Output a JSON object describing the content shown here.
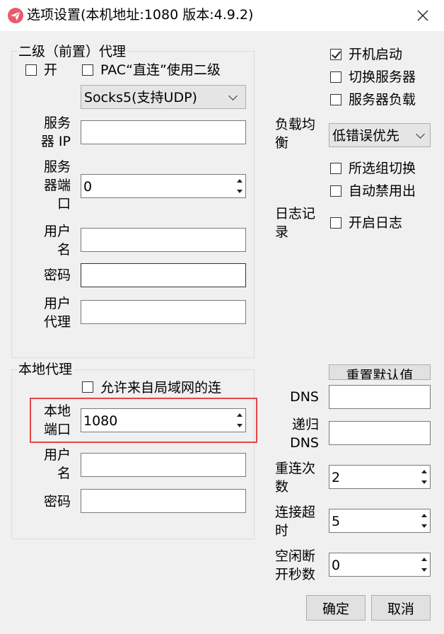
{
  "window": {
    "title": "选项设置(本机地址:1080 版本:4.9.2)"
  },
  "icons": {
    "app": "paper-plane-icon",
    "close": "close-icon"
  },
  "colors": {
    "highlight": "#e64545"
  },
  "secondary_proxy": {
    "group_title": "二级（前置）代理",
    "enable_label": "开",
    "pac_direct_label": "PAC“直连”使用二级",
    "proxy_type": "Socks5(支持UDP)",
    "server_ip_label": [
      "服务",
      "器 IP"
    ],
    "server_ip_value": "",
    "server_port_label": [
      "服务",
      "器端",
      "口"
    ],
    "server_port_value": "0",
    "username_label": [
      "用户",
      "名"
    ],
    "username_value": "",
    "password_label": "密码",
    "password_value": "",
    "user_agent_label": [
      "用户",
      "代理"
    ],
    "user_agent_value": ""
  },
  "local_proxy": {
    "group_title": "本地代理",
    "allow_lan_label": "允许来自局域网的连",
    "port_label": [
      "本地",
      "端口"
    ],
    "port_value": "1080",
    "username_label": [
      "用户",
      "名"
    ],
    "username_value": "",
    "password_label": "密码",
    "password_value": ""
  },
  "general": {
    "autostart_label": "开机启动",
    "autostart_checked": true,
    "switch_server_label": "切换服务器",
    "server_load_label": "服务器负载",
    "load_balance_label": [
      "负载均",
      "衡"
    ],
    "load_balance_value": "低错误优先",
    "group_switch_label": "所选组切换",
    "auto_ban_label": "自动禁用出",
    "log_label": [
      "日志记",
      "录"
    ],
    "enable_log_label": "开启日志",
    "reset_button": "重置默认值",
    "dns_label": "DNS",
    "dns_value": "",
    "recursive_dns_label": [
      "递归",
      "DNS"
    ],
    "recursive_dns_value": "",
    "reconnect_label": [
      "重连次",
      "数"
    ],
    "reconnect_value": "2",
    "timeout_label": [
      "连接超",
      "时"
    ],
    "timeout_value": "5",
    "idle_label": [
      "空闲断",
      "开秒数"
    ],
    "idle_value": "0"
  },
  "buttons": {
    "ok": "确定",
    "cancel": "取消"
  }
}
